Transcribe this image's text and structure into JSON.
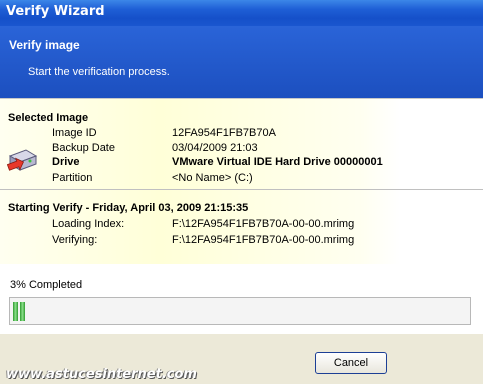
{
  "window": {
    "title": "Verify Wizard"
  },
  "header": {
    "title": "Verify image",
    "subtitle": "Start the verification process."
  },
  "selected_image": {
    "heading": "Selected Image",
    "rows": [
      {
        "label": "Image ID",
        "value": "12FA954F1FB7B70A",
        "bold": false
      },
      {
        "label": "Backup Date",
        "value": "03/04/2009 21:03",
        "bold": false
      },
      {
        "label": "Drive",
        "value": "VMware Virtual IDE Hard Drive 00000001",
        "bold": true
      },
      {
        "label": "Partition",
        "value": "<No Name> (C:)",
        "bold": false
      }
    ]
  },
  "verify": {
    "heading": "Starting Verify - Friday, April 03, 2009 21:15:35",
    "rows": [
      {
        "label": "Loading Index:",
        "value": "F:\\12FA954F1FB7B70A-00-00.mrimg"
      },
      {
        "label": "Verifying:",
        "value": "F:\\12FA954F1FB7B70A-00-00.mrimg"
      }
    ]
  },
  "progress": {
    "label": "3% Completed",
    "fraction": 0.03
  },
  "buttons": {
    "cancel": "Cancel"
  },
  "watermark": "www.astucesinternet.com",
  "icons": {
    "drive": "hard-drive-icon"
  }
}
